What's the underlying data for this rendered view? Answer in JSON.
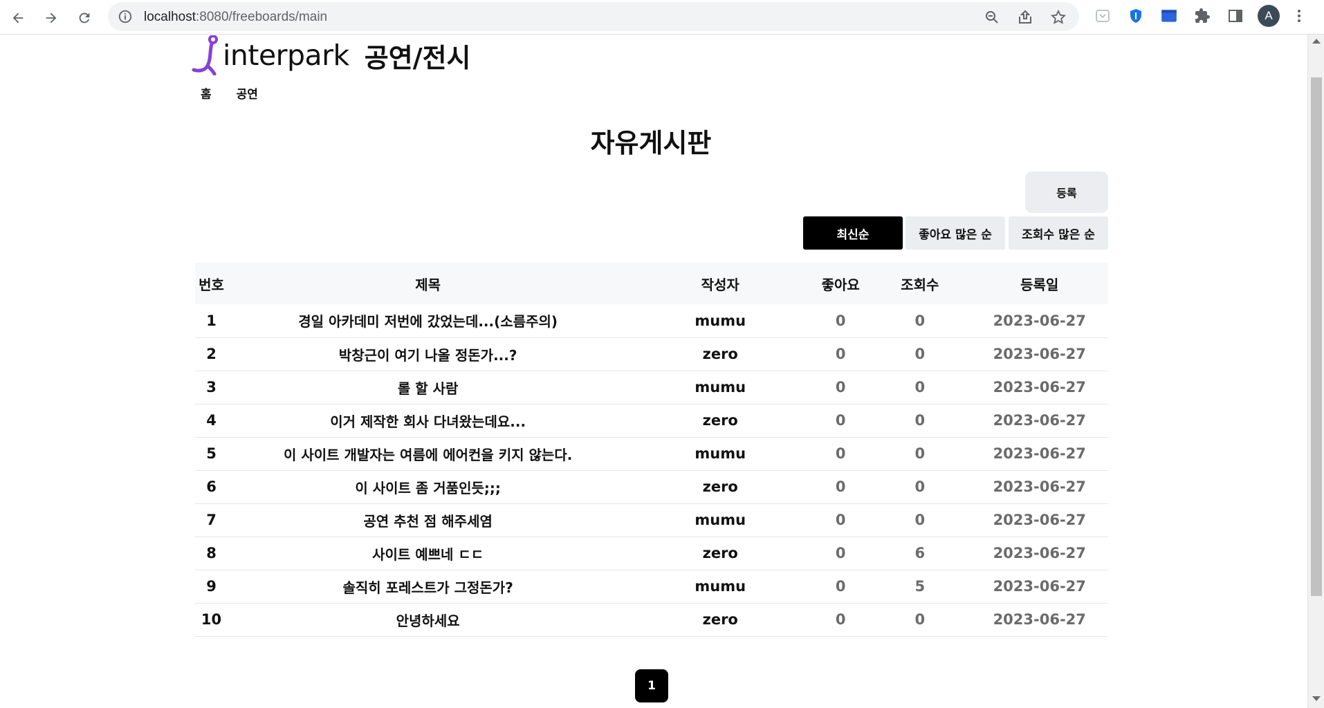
{
  "browser": {
    "url_host": "localhost",
    "url_rest": ":8080/freeboards/main",
    "profile_initial": "A"
  },
  "header": {
    "brand": "interpark",
    "section": "공연/전시",
    "nav": [
      {
        "label": "홈"
      },
      {
        "label": "공연"
      }
    ]
  },
  "board": {
    "title": "자유게시판",
    "register_label": "등록",
    "sort_options": [
      {
        "label": "최신순",
        "active": true
      },
      {
        "label": "좋아요 많은 순",
        "active": false
      },
      {
        "label": "조회수 많은 순",
        "active": false
      }
    ],
    "columns": [
      "번호",
      "제목",
      "작성자",
      "좋아요",
      "조회수",
      "등록일"
    ],
    "rows": [
      {
        "num": "1",
        "title": "경일 아카데미 저번에 갔었는데...(소름주의)",
        "author": "mumu",
        "likes": "0",
        "views": "0",
        "date": "2023-06-27"
      },
      {
        "num": "2",
        "title": "박창근이 여기 나올 정돈가...?",
        "author": "zero",
        "likes": "0",
        "views": "0",
        "date": "2023-06-27"
      },
      {
        "num": "3",
        "title": "롤 할 사람",
        "author": "mumu",
        "likes": "0",
        "views": "0",
        "date": "2023-06-27"
      },
      {
        "num": "4",
        "title": "이거 제작한 회사 다녀왔는데요...",
        "author": "zero",
        "likes": "0",
        "views": "0",
        "date": "2023-06-27"
      },
      {
        "num": "5",
        "title": "이 사이트 개발자는 여름에 에어컨을 키지 않는다.",
        "author": "mumu",
        "likes": "0",
        "views": "0",
        "date": "2023-06-27"
      },
      {
        "num": "6",
        "title": "이 사이트 좀 거품인듯;;;",
        "author": "zero",
        "likes": "0",
        "views": "0",
        "date": "2023-06-27"
      },
      {
        "num": "7",
        "title": "공연 추천 점 해주세염",
        "author": "mumu",
        "likes": "0",
        "views": "0",
        "date": "2023-06-27"
      },
      {
        "num": "8",
        "title": "사이트 예쁘네 ㄷㄷ",
        "author": "zero",
        "likes": "0",
        "views": "6",
        "date": "2023-06-27"
      },
      {
        "num": "9",
        "title": "솔직히 포레스트가 그정돈가?",
        "author": "mumu",
        "likes": "0",
        "views": "5",
        "date": "2023-06-27"
      },
      {
        "num": "10",
        "title": "안녕하세요",
        "author": "zero",
        "likes": "0",
        "views": "0",
        "date": "2023-06-27"
      }
    ],
    "pagination": {
      "current_page": "1"
    }
  },
  "colors": {
    "logo_purple": "#8a3fd6",
    "active_sort_bg": "#000000",
    "idle_button_bg": "#ebedf0",
    "header_row_bg": "#f7f8f9"
  }
}
